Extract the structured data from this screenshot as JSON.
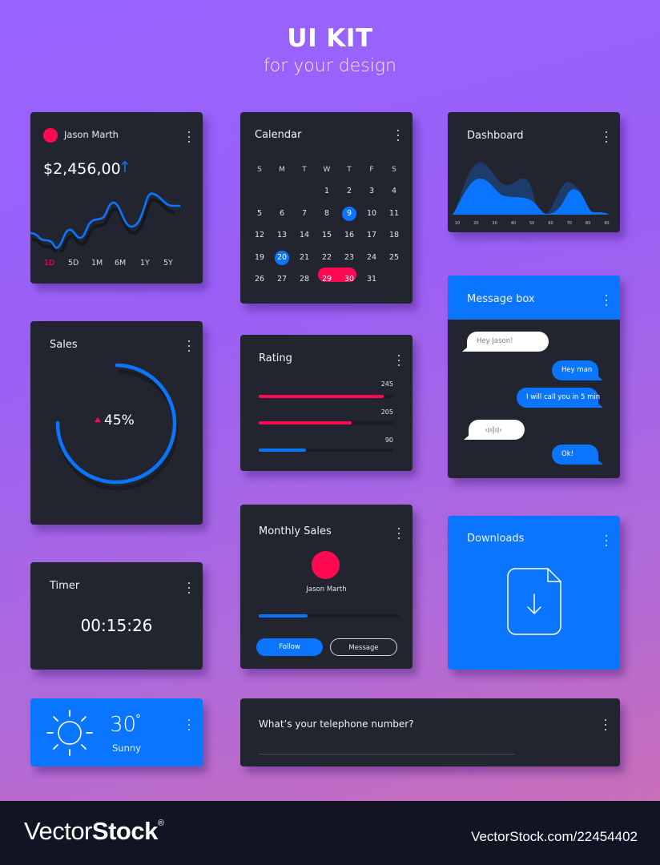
{
  "header": {
    "title": "UI KIT",
    "subtitle": "for your design"
  },
  "colors": {
    "accent_blue": "#0a75ff",
    "accent_pink": "#ff0a52",
    "card_bg": "#22252f",
    "footer_bg": "#121424"
  },
  "account_card": {
    "name": "Jason Marth",
    "amount": "$2,456,00",
    "trend_icon": "arrow-up-icon",
    "trend_glyph": "↑",
    "ranges": [
      "1D",
      "5D",
      "1M",
      "6M",
      "1Y",
      "5Y"
    ],
    "active_range": "1D"
  },
  "calendar": {
    "title": "Calendar",
    "weekdays": [
      "S",
      "M",
      "T",
      "W",
      "T",
      "F",
      "S"
    ],
    "weeks": [
      [
        "",
        "",
        "",
        "1",
        "2",
        "3",
        "4"
      ],
      [
        "5",
        "6",
        "7",
        "8",
        "9",
        "10",
        "11"
      ],
      [
        "12",
        "13",
        "14",
        "15",
        "16",
        "17",
        "18"
      ],
      [
        "19",
        "20",
        "21",
        "22",
        "23",
        "24",
        "25"
      ],
      [
        "26",
        "27",
        "28",
        "29",
        "30",
        "31",
        ""
      ]
    ],
    "highlighted_days": [
      "9",
      "20"
    ],
    "range_selected": [
      "29",
      "30"
    ]
  },
  "dashboard": {
    "title": "Dashboard",
    "x_ticks": [
      "10",
      "20",
      "30",
      "40",
      "50",
      "60",
      "70",
      "80",
      "90"
    ]
  },
  "messages": {
    "title": "Message box",
    "items": [
      {
        "dir": "in",
        "text": "Hey Jason!"
      },
      {
        "dir": "out",
        "text": "Hey man"
      },
      {
        "dir": "out",
        "text": "I will call you in 5 min"
      },
      {
        "dir": "in",
        "text": "",
        "type": "voice",
        "icon": "audio-waveform-icon"
      },
      {
        "dir": "out",
        "text": "Ok!"
      }
    ]
  },
  "sales": {
    "title": "Sales",
    "value": "45%",
    "trend_icon": "triangle-up-icon"
  },
  "rating": {
    "title": "Rating",
    "bars": [
      {
        "value": "245",
        "fraction": 0.93,
        "color": "#ff0a52"
      },
      {
        "value": "205",
        "fraction": 0.69,
        "color": "#ff0a52"
      },
      {
        "value": "90",
        "fraction": 0.35,
        "color": "#0a75ff"
      }
    ]
  },
  "monthly_sales": {
    "title": "Monthly Sales",
    "name": "Jason Marth",
    "progress": 0.35,
    "follow_label": "Follow",
    "message_label": "Message"
  },
  "downloads": {
    "title": "Downloads",
    "icon": "file-download-icon"
  },
  "timer": {
    "title": "Timer",
    "value": "00:15:26"
  },
  "weather": {
    "temperature": "30",
    "degree_symbol": "°",
    "condition": "Sunny",
    "icon": "sun-icon"
  },
  "phone": {
    "question": "What’s your telephone number?",
    "value": "",
    "placeholder": ""
  },
  "footer": {
    "brand_light": "Vector",
    "brand_bold": "Stock",
    "registered": "®",
    "stock_id": "VectorStock.com/22454402"
  }
}
